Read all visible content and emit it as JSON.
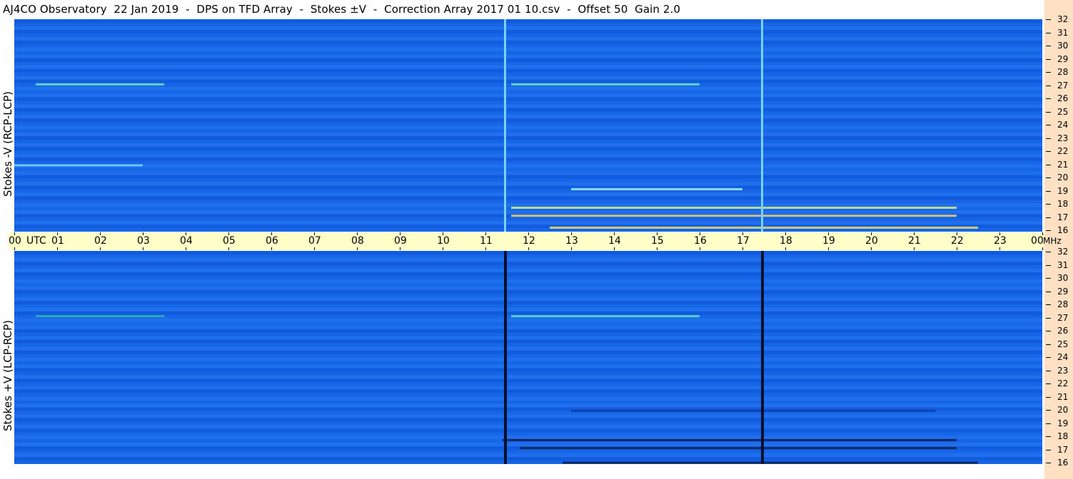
{
  "title": "AJ4CO Observatory  22 Jan 2019  -  DPS on TFD Array  -  Stokes ±V  -  Correction Array 2017 01 10.csv  -  Offset 50  Gain 2.0",
  "chart_data": [
    {
      "type": "heatmap",
      "name": "top-panel",
      "ylabel": "Stokes -V (RCP-LCP)",
      "x_unit": "UTC",
      "y_unit": "MHz",
      "xlim": [
        "00",
        "00"
      ],
      "ylim": [
        16,
        32
      ],
      "x_ticks": [
        "00",
        "01",
        "02",
        "03",
        "04",
        "05",
        "06",
        "07",
        "08",
        "09",
        "10",
        "11",
        "12",
        "13",
        "14",
        "15",
        "16",
        "17",
        "18",
        "19",
        "20",
        "21",
        "22",
        "23",
        "00"
      ],
      "y_ticks": [
        16,
        17,
        18,
        19,
        20,
        21,
        22,
        23,
        24,
        25,
        26,
        27,
        28,
        29,
        30,
        31,
        32
      ],
      "background_color": "#1565e8",
      "vertical_markers": [
        {
          "time_utc": 11.45,
          "color": "#7ad2ff"
        },
        {
          "time_utc": 17.45,
          "color": "#7ad2ff"
        }
      ],
      "features": [
        {
          "freq_mhz": 27.1,
          "t_start": 0.5,
          "t_end": 3.5,
          "color": "#6fe6c0"
        },
        {
          "freq_mhz": 27.1,
          "t_start": 11.6,
          "t_end": 16.0,
          "color": "#6fe6c0"
        },
        {
          "freq_mhz": 17.8,
          "t_start": 11.6,
          "t_end": 22.0,
          "color": "#d6f07a"
        },
        {
          "freq_mhz": 17.2,
          "t_start": 11.6,
          "t_end": 22.0,
          "color": "#f3d36b"
        },
        {
          "freq_mhz": 16.3,
          "t_start": 12.5,
          "t_end": 22.5,
          "color": "#f0e060"
        },
        {
          "freq_mhz": 19.2,
          "t_start": 13.0,
          "t_end": 17.0,
          "color": "#9ff0f0"
        },
        {
          "freq_mhz": 21.0,
          "t_start": 0.0,
          "t_end": 3.0,
          "color": "#7bd8ff"
        }
      ]
    },
    {
      "type": "heatmap",
      "name": "bottom-panel",
      "ylabel": "Stokes +V (LCP-RCP)",
      "x_unit": "UTC",
      "y_unit": "MHz",
      "ylim": [
        16,
        32
      ],
      "y_ticks": [
        16,
        17,
        18,
        19,
        20,
        21,
        22,
        23,
        24,
        25,
        26,
        27,
        28,
        29,
        30,
        31,
        32
      ],
      "background_color": "#1565e8",
      "vertical_markers": [
        {
          "time_utc": 11.45,
          "color": "#0a0f2a"
        },
        {
          "time_utc": 17.45,
          "color": "#0a0f2a"
        }
      ],
      "features": [
        {
          "freq_mhz": 27.1,
          "t_start": 0.5,
          "t_end": 3.5,
          "color": "#2cb9a8"
        },
        {
          "freq_mhz": 27.1,
          "t_start": 11.6,
          "t_end": 16.0,
          "color": "#5fe2c6"
        },
        {
          "freq_mhz": 17.8,
          "t_start": 11.4,
          "t_end": 22.0,
          "color": "#081b4d"
        },
        {
          "freq_mhz": 17.2,
          "t_start": 11.8,
          "t_end": 22.0,
          "color": "#0a1e4d"
        },
        {
          "freq_mhz": 16.1,
          "t_start": 12.8,
          "t_end": 22.5,
          "color": "#0a1e4d"
        },
        {
          "freq_mhz": 20.0,
          "t_start": 13.0,
          "t_end": 21.5,
          "color": "#0d3aa8"
        }
      ]
    }
  ],
  "time_axis": {
    "start_label": "00",
    "utc_label": "UTC",
    "end_label": "00",
    "mhz_label": "MHz"
  },
  "colors": {
    "plot_blue": "#1565e8",
    "time_bar": "#ffffc8",
    "right_strip": "#ffe0c2"
  }
}
